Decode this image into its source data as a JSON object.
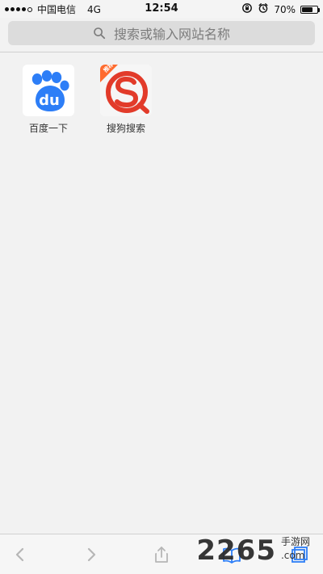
{
  "status_bar": {
    "carrier": "中国电信",
    "network": "4G",
    "time": "12:54",
    "battery_percent_label": "70%",
    "battery_fraction": 0.7
  },
  "address_bar": {
    "placeholder": "搜索或输入网站名称",
    "icons": [
      "search-icon"
    ]
  },
  "favorites": [
    {
      "label": "百度一下",
      "icon": "baidu-icon",
      "tile_text": "du"
    },
    {
      "label": "搜狗搜索",
      "icon": "sogou-icon",
      "badge_text": "推荐"
    }
  ],
  "toolbar": {
    "items": [
      {
        "name": "back",
        "icon": "chevron-left-icon"
      },
      {
        "name": "forward",
        "icon": "chevron-right-icon"
      },
      {
        "name": "share",
        "icon": "share-icon"
      },
      {
        "name": "bookmarks",
        "icon": "book-icon"
      },
      {
        "name": "tabs",
        "icon": "tabs-icon"
      }
    ]
  },
  "watermark": {
    "number": "2265",
    "suffix": "手游网",
    "tld": ".com"
  },
  "colors": {
    "background": "#f2f2f2",
    "addressbar": "#dcdcdc",
    "icon_blue": "#2d7ef7",
    "sogou_red": "#e23b2a"
  }
}
